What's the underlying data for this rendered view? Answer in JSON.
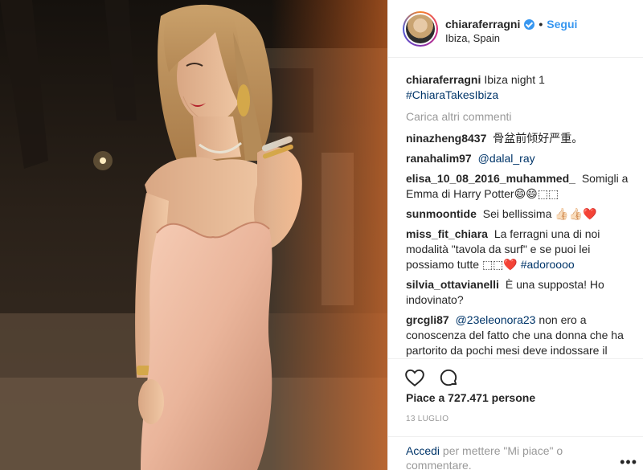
{
  "header": {
    "username": "chiaraferragni",
    "separator": "•",
    "follow_label": "Segui",
    "location": "Ibiza, Spain"
  },
  "caption": {
    "username": "chiaraferragni",
    "text": "Ibiza night 1",
    "hashtag": "#ChiaraTakesIbiza"
  },
  "load_more": "Carica altri commenti",
  "comments": [
    {
      "user": "ninazheng8437",
      "text": "骨盆前倾好严重。"
    },
    {
      "user": "ranahalim97",
      "mention": "@dalal_ray",
      "text": ""
    },
    {
      "user": "elisa_10_08_2016_muhammed_",
      "text": "Somigli a Emma di Harry Potter😄😄⬚⬚"
    },
    {
      "user": "sunmoontide",
      "text": "Sei bellissima 👍🏻👍🏻❤️"
    },
    {
      "user": "miss_fit_chiara",
      "text": "La ferragni una di noi modalità \"tavola da surf\" e se puoi lei possiamo tutte ⬚⬚❤️",
      "hashtag": "#adoroooo"
    },
    {
      "user": "silvia_ottavianelli",
      "text": "È una supposta! Ho indovinato?"
    },
    {
      "user": "grcgli87",
      "mention": "@23eleonora23",
      "text": "non ero a conoscenza del fatto che una donna che ha partorito da pochi mesi deve indossare il burqa."
    }
  ],
  "likes": "Piace a 727.471 persone",
  "date": "13 LUGLIO",
  "login": {
    "link": "Accedi",
    "rest": "per mettere \"Mi piace\" o commentare."
  },
  "more_label": "•••",
  "icons": {
    "like": "heart-icon",
    "comment": "comment-icon",
    "verified": "verified-badge-icon",
    "more": "more-options-icon"
  },
  "colors": {
    "accent": "#3897f0",
    "link": "#003569",
    "muted": "#999999",
    "text": "#262626"
  }
}
